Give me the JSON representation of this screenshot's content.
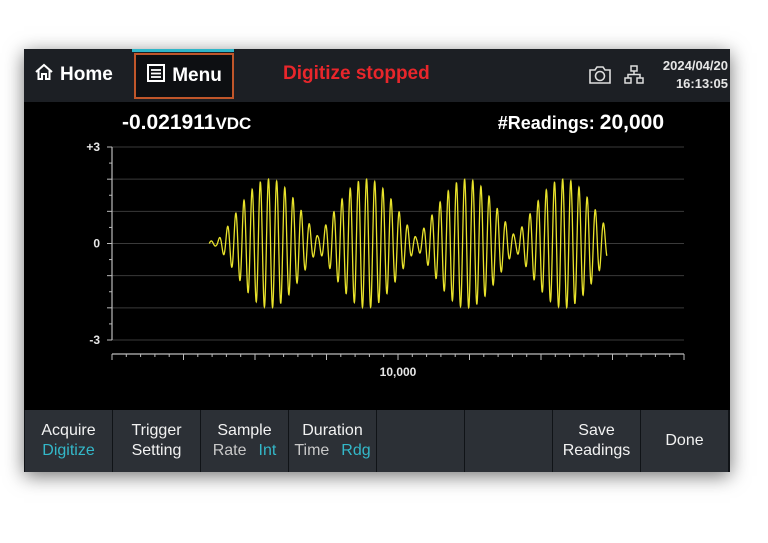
{
  "topbar": {
    "home_label": "Home",
    "menu_label": "Menu",
    "status": "Digitize stopped",
    "date": "2024/04/20",
    "time": "16:13:05"
  },
  "measurement": {
    "value": "-0.021911",
    "unit": "VDC",
    "readings_label": "#Readings:",
    "readings_value": "20,000"
  },
  "chart_data": {
    "type": "line",
    "ylim": [
      -3,
      3
    ],
    "y_tick_labels": [
      "+3",
      "0",
      "-3"
    ],
    "x_tick_labels": [
      "10,000"
    ],
    "xlim": [
      0,
      20000
    ],
    "grid": true,
    "series": [
      {
        "description": "amplitude-modulated sinusoid, four bursts",
        "burst_centers": [
          5500,
          8900,
          12400,
          15800
        ],
        "burst_half_width": 2000,
        "peak_amplitude": 2,
        "carrier_cycles_per_burst": 14,
        "start_x": 3400,
        "end_x": 17300,
        "color": "#e8e22b"
      }
    ]
  },
  "softkeys": [
    {
      "top": "Acquire",
      "sub": "Digitize"
    },
    {
      "top": "Trigger",
      "bottom": "Setting"
    },
    {
      "top": "Sample",
      "sub_label": "Rate",
      "sub": "Int"
    },
    {
      "top": "Duration",
      "sub_label": "Time",
      "sub": "Rdg"
    },
    {
      "top": ""
    },
    {
      "top": ""
    },
    {
      "top": "Save",
      "bottom": "Readings"
    },
    {
      "top": "Done"
    }
  ],
  "colors": {
    "accent": "#33b8c9",
    "status": "#e8262b",
    "waveform": "#e8e22b"
  }
}
